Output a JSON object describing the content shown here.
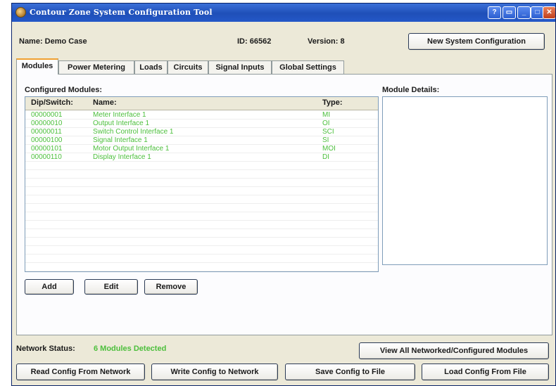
{
  "window": {
    "title": "Contour Zone System Configuration Tool"
  },
  "header": {
    "name_label": "Name: Demo Case",
    "id_label": "ID: 66562",
    "version_label": "Version: 8",
    "new_config_label": "New System Configuration"
  },
  "tabs": [
    {
      "label": "Modules"
    },
    {
      "label": "Power Metering"
    },
    {
      "label": "Loads"
    },
    {
      "label": "Circuits"
    },
    {
      "label": "Signal Inputs"
    },
    {
      "label": "Global Settings"
    }
  ],
  "modules": {
    "heading": "Configured Modules:",
    "columns": [
      "Dip/Switch:",
      "Name:",
      "Type:"
    ],
    "rows": [
      {
        "dip": "00000001",
        "name": "Meter Interface 1",
        "type": "MI"
      },
      {
        "dip": "00000010",
        "name": "Output Interface 1",
        "type": "OI"
      },
      {
        "dip": "00000011",
        "name": "Switch Control Interface 1",
        "type": "SCI"
      },
      {
        "dip": "00000100",
        "name": "Signal Interface 1",
        "type": "SI"
      },
      {
        "dip": "00000101",
        "name": "Motor Output Interface 1",
        "type": "MOI"
      },
      {
        "dip": "00000110",
        "name": "Display Interface 1",
        "type": "DI"
      }
    ],
    "add_label": "Add",
    "edit_label": "Edit",
    "remove_label": "Remove"
  },
  "details": {
    "heading": "Module Details:"
  },
  "status": {
    "label": "Network Status:",
    "value": "6 Modules Detected",
    "view_all_label": "View All Networked/Configured Modules"
  },
  "footer": {
    "read_label": "Read Config From Network",
    "write_label": "Write Config to Network",
    "save_label": "Save Config to File",
    "load_label": "Load Config From File"
  },
  "colors": {
    "titlebar": "#1f4fb8",
    "status_green": "#4cbf3c",
    "active_tab_accent": "#f0a030"
  }
}
